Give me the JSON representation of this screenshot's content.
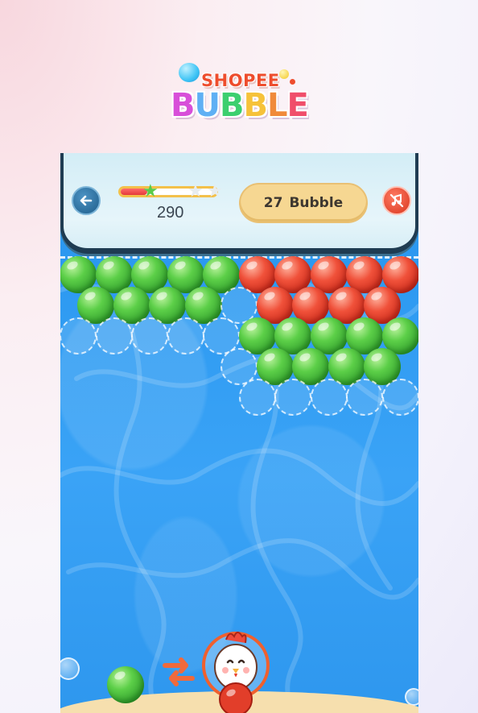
{
  "logo": {
    "brand": "SHOPEE",
    "title_letters": [
      "B",
      "U",
      "B",
      "B",
      "L",
      "E"
    ]
  },
  "header": {
    "score": "290",
    "bubbles_left_count": "27",
    "bubbles_left_label": "Bubble",
    "progress": 0.28,
    "stars_earned": 1,
    "stars_total": 3
  },
  "colors": {
    "green": "#4cbf3c",
    "red": "#e23e2a",
    "water": "#2d9bf0",
    "header_bg": "#e2f3f9",
    "pill_bg": "#f6d792"
  },
  "icons": {
    "back": "arrow-left-icon",
    "music": "music-off-icon",
    "swap": "swap-arrows-icon"
  },
  "grid": {
    "rows": [
      [
        "G",
        "G",
        "G",
        "G",
        "G",
        "R",
        "R",
        "R",
        "R",
        "R"
      ],
      [
        "G",
        "G",
        "G",
        "G",
        "E",
        "R",
        "R",
        "R",
        "R"
      ],
      [
        "E",
        "E",
        "E",
        "E",
        "E",
        "G",
        "G",
        "G",
        "G",
        "G"
      ],
      [
        "",
        "",
        "",
        "",
        "E",
        "G",
        "G",
        "G",
        "G"
      ],
      [
        "",
        "",
        "",
        "",
        "",
        "E",
        "E",
        "E",
        "E",
        "E"
      ]
    ]
  },
  "shooter": {
    "current": "red",
    "next": "green"
  }
}
